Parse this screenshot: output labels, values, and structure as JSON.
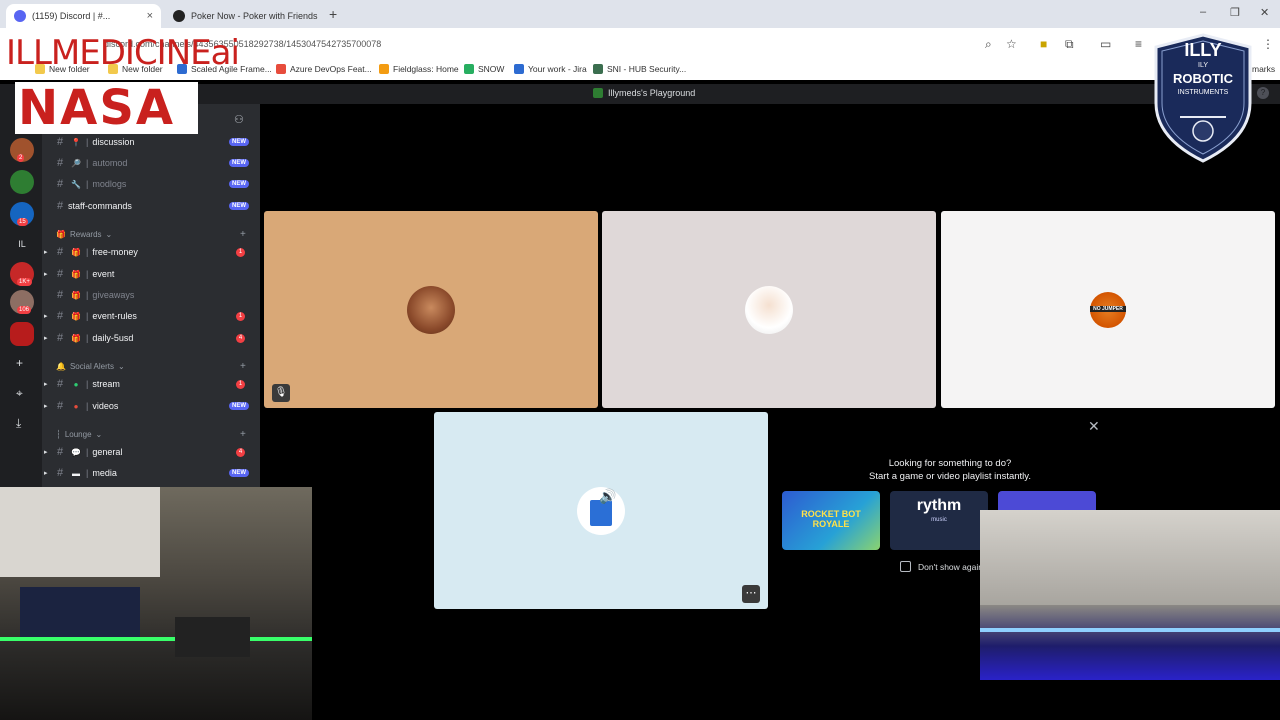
{
  "browser": {
    "tabs": [
      {
        "title": "(1159) Discord | #...",
        "active": true
      },
      {
        "title": "Poker Now - Poker with Friends",
        "active": false
      }
    ],
    "new_tab": "+",
    "url": "discord.com/channels/443563550518292738/1453047542735700078",
    "window_controls": [
      "–",
      "❐",
      "✕"
    ],
    "bookmarks": [
      {
        "label": "New folder",
        "icon": "folder-icon",
        "color": "#f2c94c"
      },
      {
        "label": "New folder",
        "icon": "folder-icon",
        "color": "#f2c94c"
      },
      {
        "label": "Scaled Agile Frame...",
        "icon": "safe-icon",
        "color": "#2d6bd1"
      },
      {
        "label": "Azure DevOps Feat...",
        "icon": "windows-icon",
        "color": "#e74c3c"
      },
      {
        "label": "Fieldglass: Home",
        "icon": "fieldglass-icon",
        "color": "#f39c12"
      },
      {
        "label": "SNOW",
        "icon": "windows-icon",
        "color": "#27ae60"
      },
      {
        "label": "Your work - Jira",
        "icon": "jira-icon",
        "color": "#2d6bd1"
      },
      {
        "label": "SNI - HUB Security...",
        "icon": "shield-icon",
        "color": "#3b6e4f"
      }
    ],
    "bookmarks_overflow": "marks"
  },
  "overlay": {
    "brand_text": "ILLMEDICINEai",
    "nasa_text": "NASA",
    "shield": {
      "line1": "ILLY",
      "line2": "ILY",
      "line3": "ROBOTIC",
      "line4": "INSTRUMENTS"
    }
  },
  "discord": {
    "server_name": "Illymeds's Playground",
    "servers": [
      {
        "color": "#a0522d",
        "badge": "2"
      },
      {
        "color": "#2e7d32",
        "badge": ""
      },
      {
        "color": "#1565c0",
        "badge": "15"
      },
      {
        "color": "#1e1f22",
        "badge": "",
        "label": "IL"
      },
      {
        "color": "#c62828",
        "badge": "1K+"
      },
      {
        "color": "#8d6e63",
        "badge": "106"
      },
      {
        "color": "#b71c1c",
        "badge": ""
      }
    ],
    "rail_actions": [
      "+",
      "⌖",
      "⤓"
    ],
    "categories": [
      {
        "name": "Rewards",
        "chev": "⌄"
      },
      {
        "name": "Social Alerts",
        "chev": "⌄"
      },
      {
        "name": "Lounge",
        "chev": "⌄"
      }
    ],
    "channels": [
      {
        "name": "discussion",
        "emoji": "📍",
        "badge": "NEW",
        "count": "",
        "dim": false
      },
      {
        "name": "automod",
        "emoji": "🔎",
        "badge": "NEW",
        "count": "",
        "dim": true
      },
      {
        "name": "modlogs",
        "emoji": "🔧",
        "badge": "NEW",
        "count": "",
        "dim": true
      },
      {
        "name": "staff-commands",
        "emoji": "",
        "badge": "NEW",
        "count": "",
        "dim": false
      },
      {
        "name": "free-money",
        "emoji": "🎁",
        "badge": "",
        "count": "1",
        "dim": false
      },
      {
        "name": "event",
        "emoji": "🎁",
        "badge": "",
        "count": "",
        "dim": false
      },
      {
        "name": "giveaways",
        "emoji": "🎁",
        "badge": "",
        "count": "",
        "dim": true
      },
      {
        "name": "event-rules",
        "emoji": "🎁",
        "badge": "",
        "count": "1",
        "dim": false
      },
      {
        "name": "daily-5usd",
        "emoji": "🎁",
        "badge": "",
        "count": "4",
        "dim": false
      },
      {
        "name": "stream",
        "emoji": "●",
        "badge": "",
        "count": "1",
        "dim": false
      },
      {
        "name": "videos",
        "emoji": "●",
        "badge": "NEW",
        "count": "",
        "dim": false
      },
      {
        "name": "general",
        "emoji": "💬",
        "badge": "",
        "count": "4",
        "dim": false
      },
      {
        "name": "media",
        "emoji": "▬",
        "badge": "NEW",
        "count": "",
        "dim": false
      }
    ],
    "tiles": [
      {
        "bg": "#d9a877",
        "avatar": "#8b4a2b"
      },
      {
        "bg": "#dfd8d8",
        "avatar": "#ffffff"
      },
      {
        "bg": "#f5f4f4",
        "avatar": "#d35400"
      },
      {
        "bg": "#d7eaf2",
        "avatar": "#2b6fd6"
      }
    ],
    "avatar_label": "NO JUMPER",
    "activity": {
      "heading": "Looking for something to do?",
      "subheading": "Start a game or video playlist instantly.",
      "dont_show": "Don't show again",
      "cards": [
        {
          "label": "ROCKET BOT ROYALE",
          "bg": "#27a1d6"
        },
        {
          "label": "rythm",
          "sub": "music",
          "bg": "#1f2a44"
        },
        {
          "label": "",
          "bg": "#4c4ad6"
        }
      ]
    },
    "more_button": "⋯",
    "close": "✕"
  }
}
